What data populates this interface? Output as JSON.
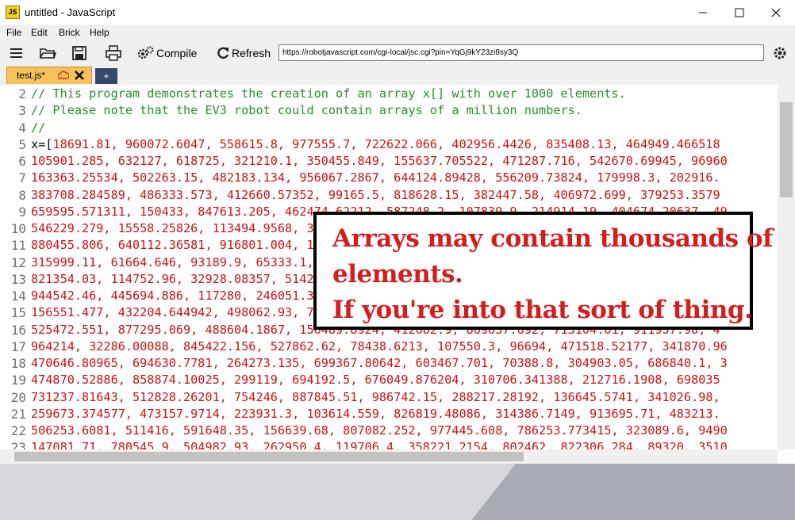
{
  "window": {
    "title": "untitled - JavaScript",
    "icon_text": "JS",
    "controls": [
      "minimize-icon",
      "maximize-icon",
      "close-icon"
    ]
  },
  "menu": {
    "items": [
      "File",
      "Edit",
      "Brick",
      "Help"
    ]
  },
  "toolbar": {
    "icons": [
      "hamburger-menu-icon",
      "open-folder-icon",
      "save-icon",
      "print-icon"
    ],
    "compile_label": "Compile",
    "refresh_label": "Refresh",
    "url_value": "https://robotjavascript.com/cgi-local/jsc.cgi?pin=YqGj9kY23zi8sy3Q",
    "settings_icon": "gear-icon"
  },
  "tabs": {
    "active_label": "test.js*",
    "new_tab_label": "+"
  },
  "editor": {
    "line_numbers": [
      "2",
      "3",
      "4",
      "5",
      "6",
      "7",
      "8",
      "9",
      "10",
      "11",
      "12",
      "13",
      "14",
      "15",
      "16",
      "17",
      "18",
      "19",
      "20",
      "21",
      "22",
      "23"
    ],
    "comments": [
      "// This program demonstrates the creation of an array x[] with over 1000 elements.",
      "// Please note that the EV3 robot could contain arrays of a million numbers.",
      "//"
    ],
    "first_code_prefix": "x=[",
    "number_lines": [
      "18691.81, 960072.6047, 558615.8, 977555.7, 722622.066, 402956.4426, 835408.13, 464949.466518",
      "105901.285, 632127, 618725, 321210.1, 350455.849, 155637.705522, 471287.716, 542670.69945, 96960",
      "163363.25534, 502263.15, 482183.134, 956067.2867, 644124.89428, 556209.73824, 179998.3, 202916.",
      "383708.284589, 486333.573, 412660.57352, 99165.5, 818628.15, 382447.58, 406972.699, 379253.3579",
      "659595.571311, 150433, 847613.205, 462474.62212, 587248.2, 107839.9, 214914.19, 404674.20637, 49",
      "546229.279, 15558.25826, 113494.9568, 336472.1, 601339.2, 729143.1, 420151.2, 556210.35, 8653",
      "880455.806, 640112.36581, 916801.004, 112040.8, 476431.3, 205571.7, 316294.1, 716321.72, 42",
      "315999.11, 61664.646, 93189.9, 65333.1, 419672.6, 710412.4, 604224.47, 871630.2, 98114.2, 289",
      "821354.03, 114752.96, 32928.08357, 51420.4, 301772.6, 519023.58, 60341.7, 413090.3, 90213, 3",
      "944542.46, 445694.886, 117280, 246051.33, 77105.5, 814022.14, 302714.3, 114592.7, 61088.2, 3",
      "156551.477, 432204.644942, 498062.93, 74120.1, 561023.3, 907214.55, 210034.21, 71490.8, 8493",
      "525472.551, 877295.069, 488604.1867, 156489.8924, 412682.9, 869637.692, 713104.01, 911957.98, 4",
      "964214, 32286.00088, 845422.156, 527862.62, 78438.6213, 107550.3, 96694, 471518.52177, 341870.96",
      "470646.80965, 694630.7781, 264273.135, 699367.80642, 603467.701, 70388.8, 304903.05, 686840.1, 3",
      "474870.52886, 858874.10025, 299119, 694192.5, 676049.876204, 310706.341388, 212716.1908, 698035",
      "731237.81643, 512828.26201, 754246, 887845.51, 986742.15, 288217.28192, 136645.5741, 341026.98,",
      "259673.374577, 473157.9714, 223931.3, 103614.559, 826819.48086, 314386.7149, 913695.71, 483213.",
      "506253.6081, 511416, 591648.35, 156639.68, 807082.252, 977445.608, 786253.773415, 323089.6, 9490",
      "147081.71, 780545.9, 504982.93, 262950.4, 119706.4, 358221.2154, 802462, 822306.284, 89320, 3510"
    ]
  },
  "overlay": {
    "lines": [
      "Arrays may contain thousands of",
      "elements.",
      "If you're into that sort of thing."
    ]
  },
  "colors": {
    "comment": "#22922a",
    "number": "#cc1212",
    "overlay_text": "#d41d1d",
    "tab_active": "#f7c25a",
    "tab_new": "#35496b"
  }
}
